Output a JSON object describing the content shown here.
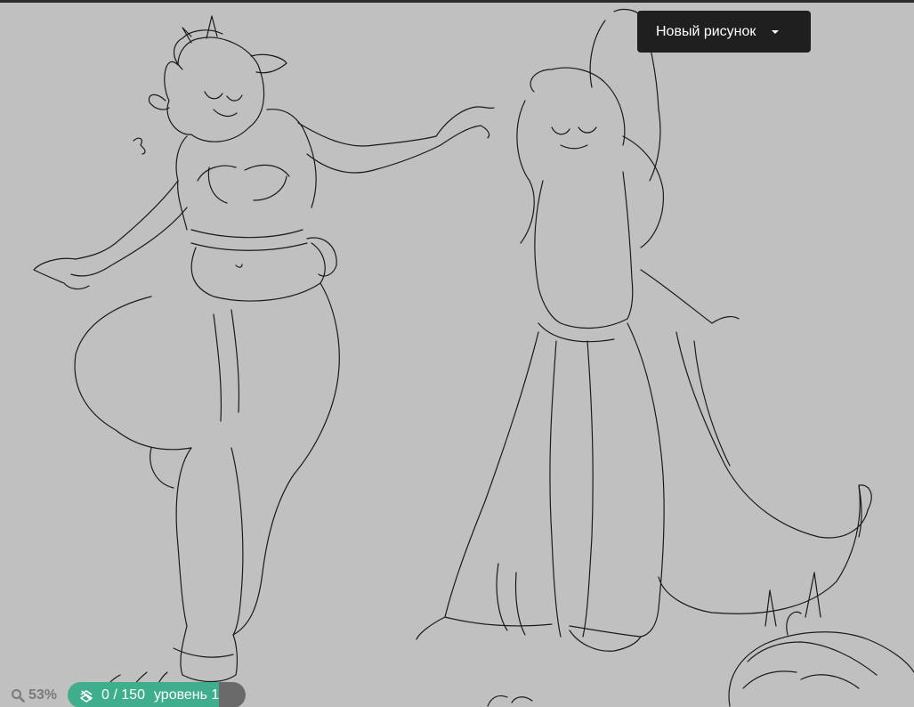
{
  "header": {
    "document_menu_label": "Новый рисунок",
    "document_menu_icon": "caret-down-icon"
  },
  "status": {
    "zoom_icon": "magnifier-icon",
    "zoom_label": "53%",
    "layer_icon": "layers-icon",
    "stroke_count": "0 / 150",
    "level_label": "уровень 1",
    "stroke_progress": 0.0
  },
  "colors": {
    "canvas_background": "#c0c0c0",
    "sketch_line": "#1a1a1a",
    "menu_background": "#1f1f1f",
    "accent": "#3fae8c"
  }
}
